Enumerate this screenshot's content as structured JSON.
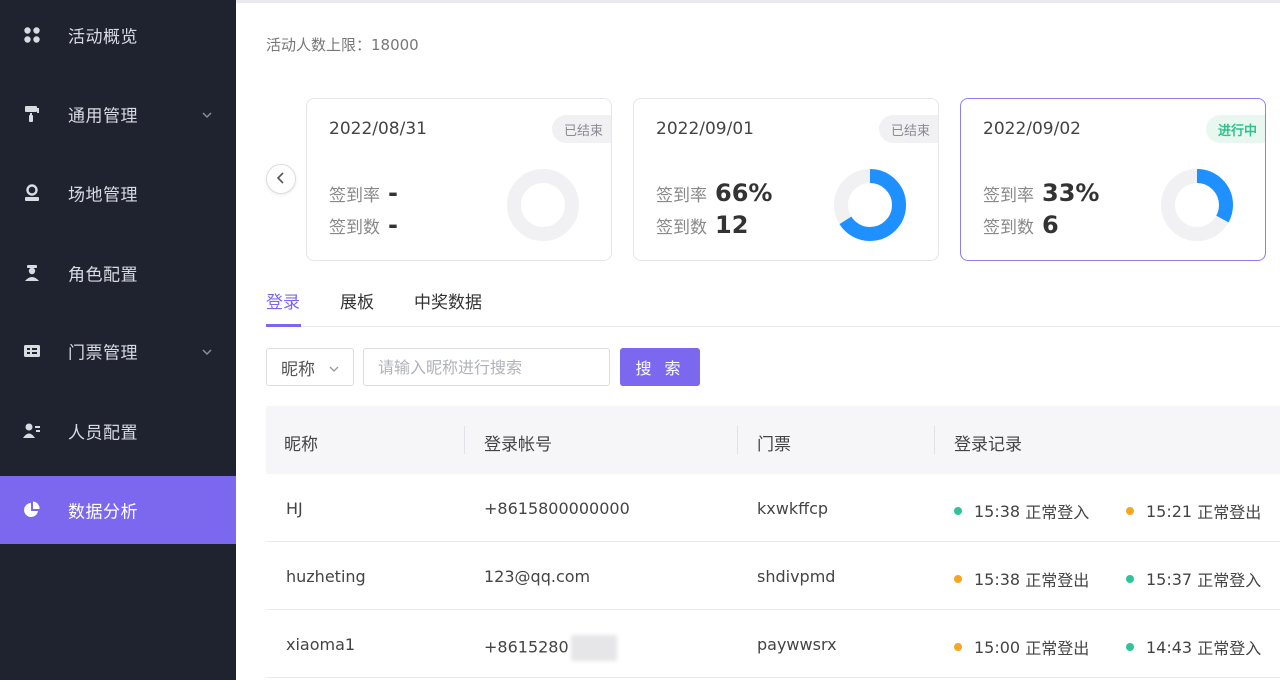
{
  "colors": {
    "accent": "#7b68ee",
    "sidebar_bg": "#1f2330",
    "donut_fill": "#1e90ff",
    "donut_track": "#f1f1f3",
    "status_login": "#2ec49a",
    "status_logout": "#f5a623"
  },
  "sidebar": {
    "items": [
      {
        "label": "活动概览",
        "icon": "grid-icon"
      },
      {
        "label": "通用管理",
        "icon": "paint-roller-icon",
        "expandable": true
      },
      {
        "label": "场地管理",
        "icon": "location-user-icon"
      },
      {
        "label": "角色配置",
        "icon": "user-badge-icon"
      },
      {
        "label": "门票管理",
        "icon": "ticket-icon",
        "expandable": true
      },
      {
        "label": "人员配置",
        "icon": "person-list-icon"
      },
      {
        "label": "数据分析",
        "icon": "pie-chart-icon",
        "active": true
      }
    ]
  },
  "header": {
    "limit_text": "活动人数上限：18000"
  },
  "cards": [
    {
      "date": "2022/08/31",
      "status": "已结束",
      "rate_label": "签到率",
      "rate": "-",
      "count_label": "签到数",
      "count": "-",
      "progress": 0
    },
    {
      "date": "2022/09/01",
      "status": "已结束",
      "rate_label": "签到率",
      "rate": "66%",
      "count_label": "签到数",
      "count": "12",
      "progress": 0.66
    },
    {
      "date": "2022/09/02",
      "status": "进行中",
      "rate_label": "签到率",
      "rate": "33%",
      "count_label": "签到数",
      "count": "6",
      "progress": 0.33
    }
  ],
  "tabs": [
    "登录",
    "展板",
    "中奖数据"
  ],
  "search": {
    "field_select": "昵称",
    "placeholder": "请输入昵称进行搜索",
    "button": "搜 索"
  },
  "table": {
    "columns": [
      "昵称",
      "登录帐号",
      "门票",
      "登录记录"
    ],
    "rows": [
      {
        "nickname": "HJ",
        "account": "+8615800000000",
        "ticket": "kxwkffcp",
        "records": [
          {
            "time": "15:38",
            "event": "正常登入",
            "type": "login"
          },
          {
            "time": "15:21",
            "event": "正常登出",
            "type": "logout"
          }
        ]
      },
      {
        "nickname": "huzheting",
        "account": "123@qq.com",
        "ticket": "shdivpmd",
        "records": [
          {
            "time": "15:38",
            "event": "正常登出",
            "type": "logout"
          },
          {
            "time": "15:37",
            "event": "正常登入",
            "type": "login"
          }
        ]
      },
      {
        "nickname": "xiaoma1",
        "account": "+8615280",
        "ticket": "paywwsrx",
        "records": [
          {
            "time": "15:00",
            "event": "正常登出",
            "type": "logout"
          },
          {
            "time": "14:43",
            "event": "正常登入",
            "type": "login"
          }
        ]
      }
    ]
  }
}
